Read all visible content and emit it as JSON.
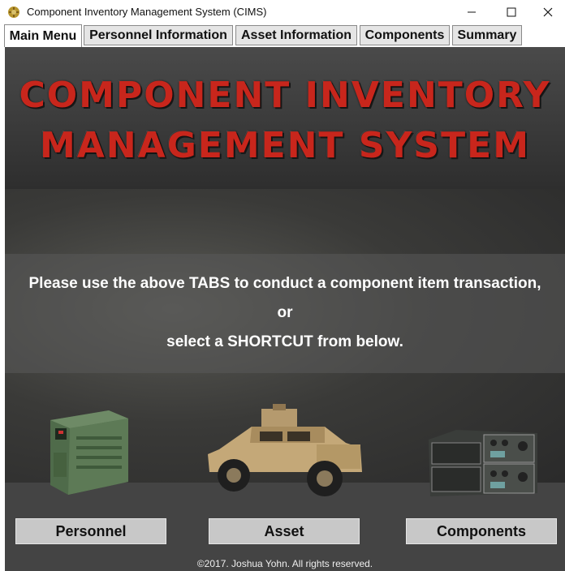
{
  "window": {
    "title": "Component Inventory Management System (CIMS)",
    "controls": [
      "minimize-icon",
      "maximize-icon",
      "close-icon"
    ]
  },
  "tabs": [
    {
      "label": "Main Menu",
      "active": true
    },
    {
      "label": "Personnel Information",
      "active": false
    },
    {
      "label": "Asset Information",
      "active": false
    },
    {
      "label": "Components",
      "active": false
    },
    {
      "label": "Summary",
      "active": false
    }
  ],
  "banner": {
    "line1": "COMPONENT INVENTORY",
    "line2": "MANAGEMENT SYSTEM",
    "color": "#c8261c"
  },
  "instructions": {
    "line1": "Please use the above TABS to conduct a component item transaction,",
    "line2": "or",
    "line3": "select a SHORTCUT from below."
  },
  "shortcuts": [
    {
      "label": "Personnel",
      "image": "generator-image"
    },
    {
      "label": "Asset",
      "image": "humvee-image"
    },
    {
      "label": "Components",
      "image": "radio-rack-image"
    }
  ],
  "footer": "©2017. Joshua Yohn. All rights reserved."
}
